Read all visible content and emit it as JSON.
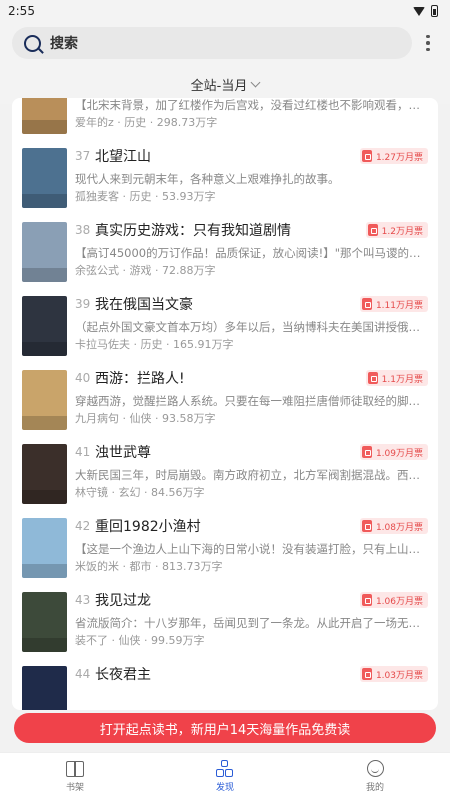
{
  "status": {
    "time": "2:55",
    "wifi_icon": "wifi-icon",
    "battery_icon": "battery-icon"
  },
  "search": {
    "placeholder": "搜索",
    "icon": "search-icon"
  },
  "filter": {
    "label": "全站-当月"
  },
  "books": [
    {
      "rank": "",
      "title": "",
      "ticket": "",
      "desc": "【北宋末背景，加了红楼作为后宫戏，没看过红楼也不影响观看，红楼梦",
      "author": "爱年的z",
      "genre": "历史",
      "words": "298.73万字",
      "cover_color": "#b98f5a"
    },
    {
      "rank": "37",
      "title": "北望江山",
      "ticket": "1.27万月票",
      "desc": "现代人来到元朝末年，各种意义上艰难挣扎的故事。",
      "author": "孤独麦客",
      "genre": "历史",
      "words": "53.93万字",
      "cover_color": "#4d7190"
    },
    {
      "rank": "38",
      "title": "真实历史游戏：只有我知道剧情",
      "ticket": "1.2万月票",
      "desc": "【高订45000的万订作品！品质保证，放心阅读!】\"那个叫马谡的思想",
      "author": "余弦公式",
      "genre": "游戏",
      "words": "72.88万字",
      "cover_color": "#8a9fb5"
    },
    {
      "rank": "39",
      "title": "我在俄国当文豪",
      "ticket": "1.11万月票",
      "desc": "（起点外国文豪文首本万均）多年以后，当纳博科夫在美国讲授俄国文学",
      "author": "卡拉马佐夫",
      "genre": "历史",
      "words": "165.91万字",
      "cover_color": "#2e3440"
    },
    {
      "rank": "40",
      "title": "西游：拦路人!",
      "ticket": "1.1万月票",
      "desc": "穿越西游，觉醒拦路人系统。只要在每一难阻拦唐僧师徒取经的脚步，",
      "author": "九月病句",
      "genre": "仙侠",
      "words": "93.58万字",
      "cover_color": "#c9a46a"
    },
    {
      "rank": "41",
      "title": "浊世武尊",
      "ticket": "1.09万月票",
      "desc": "大新民国三年，时局崩毁。南方政府初立，北方军阀割据混战。西洋诸国",
      "author": "林守镜",
      "genre": "玄幻",
      "words": "84.56万字",
      "cover_color": "#3b2f2a"
    },
    {
      "rank": "42",
      "title": "重回1982小渔村",
      "ticket": "1.08万月票",
      "desc": "【这是一个渔边人上山下海的日常小说！没有装逼打脸，只有上山下海",
      "author": "米饭的米",
      "genre": "都市",
      "words": "813.73万字",
      "cover_color": "#8fb9d8"
    },
    {
      "rank": "43",
      "title": "我见过龙",
      "ticket": "1.06万月票",
      "desc": "省流版简介：十八岁那年，岳闻见到了一条龙。从此开启了一场无厘头",
      "author": "装不了",
      "genre": "仙侠",
      "words": "99.59万字",
      "cover_color": "#3d4a3a"
    },
    {
      "rank": "44",
      "title": "长夜君主",
      "ticket": "1.03万月票",
      "desc": "",
      "author": "",
      "genre": "",
      "words": "",
      "cover_color": "#1f2b4a"
    }
  ],
  "cta": {
    "label": "打开起点读书，新用户14天海量作品免费读"
  },
  "tabs": [
    {
      "label": "书架",
      "icon": "book-icon"
    },
    {
      "label": "发现",
      "icon": "discover-icon"
    },
    {
      "label": "我的",
      "icon": "profile-icon"
    }
  ],
  "colors": {
    "accent": "#2a5cd6",
    "cta": "#f0424a",
    "ticket_text": "#e54b4b",
    "ticket_bg": "#fde7e7"
  }
}
